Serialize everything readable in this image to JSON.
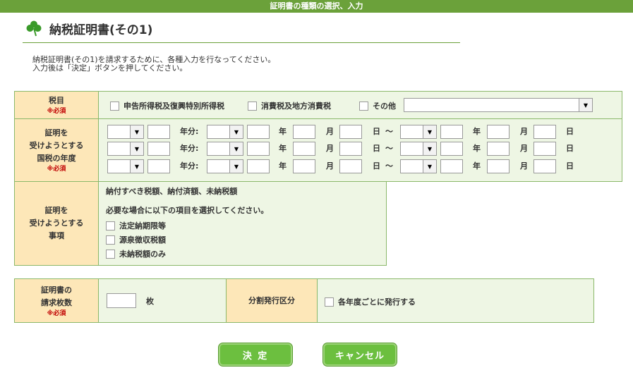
{
  "header": {
    "title": "証明書の種類の選択、入力"
  },
  "page": {
    "title": "納税証明書(その1)",
    "intro_line1": "納税証明書(その1)を請求するために、各種入力を行なってください。",
    "intro_line2": "入力後は「決定」ボタンを押してください。"
  },
  "tax_item": {
    "label": "税目",
    "required": "※必須",
    "options": [
      "申告所得税及復興特別所得税",
      "消費税及地方消費税",
      "その他"
    ]
  },
  "year_section": {
    "label_lines": [
      "証明を",
      "受けようとする",
      "国税の年度"
    ],
    "required": "※必須",
    "row_labels": {
      "year_part": "年分:",
      "year": "年",
      "month": "月",
      "day": "日",
      "range": "～"
    }
  },
  "matters_section": {
    "label_lines": [
      "証明を",
      "受けようとする",
      "事項"
    ],
    "heading": "納付すべき税額、納付済額、未納税額",
    "instruction": "必要な場合に以下の項目を選択してください。",
    "options": [
      "法定納期限等",
      "源泉徴収税額",
      "未納税額のみ"
    ]
  },
  "count_section": {
    "label_lines": [
      "証明書の",
      "請求枚数"
    ],
    "required": "※必須",
    "unit": "枚",
    "split_label": "分割発行区分",
    "split_option": "各年度ごとに発行する"
  },
  "buttons": {
    "confirm": "決 定",
    "cancel": "キャンセル"
  }
}
